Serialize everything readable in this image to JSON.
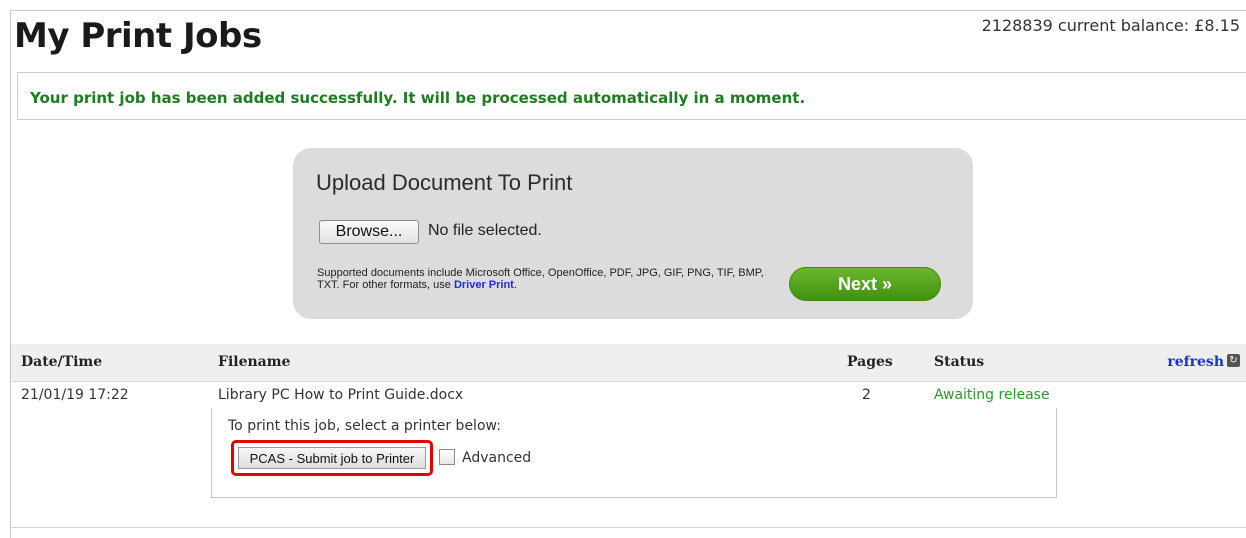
{
  "header": {
    "title": "My Print Jobs",
    "balance": "2128839 current balance: £8.15"
  },
  "notice": {
    "message": "Your print job has been added successfully. It will be processed automatically in a moment."
  },
  "upload": {
    "title": "Upload Document To Print",
    "browse_label": "Browse...",
    "file_status": "No file selected.",
    "supported_text": "Supported documents include Microsoft Office, OpenOffice, PDF, JPG, GIF, PNG, TIF, BMP, TXT. For other formats, use ",
    "driver_print_link": "Driver Print",
    "supported_suffix": ".",
    "next_label": "Next »"
  },
  "table": {
    "columns": {
      "datetime": "Date/Time",
      "filename": "Filename",
      "pages": "Pages",
      "status": "Status"
    },
    "refresh_label": "refresh",
    "rows": [
      {
        "datetime": "21/01/19 17:22",
        "filename": "Library PC How to Print Guide.docx",
        "pages": "2",
        "status": "Awaiting release"
      }
    ],
    "print_panel": {
      "instruction": "To print this job, select a printer below:",
      "submit_label": "PCAS - Submit job to Printer",
      "advanced_label": "Advanced",
      "advanced_checked": false
    }
  },
  "colors": {
    "success_text": "#1e7d1e",
    "status_text": "#2a9a2a",
    "link": "#1a2fd8",
    "next_button": "#4fa01a",
    "highlight_border": "#e60000"
  }
}
